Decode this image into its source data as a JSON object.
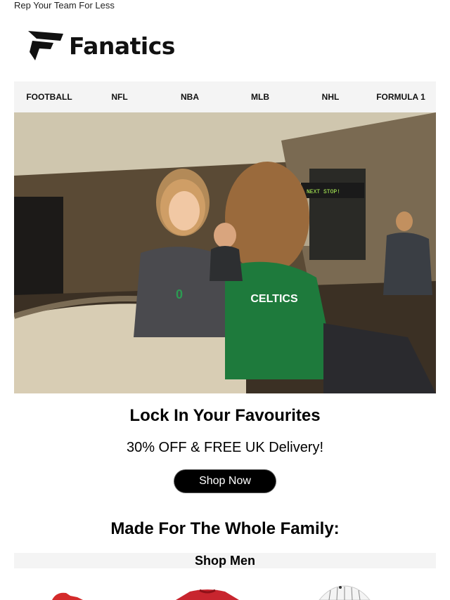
{
  "preheader": "Rep Your Team For Less",
  "brand": {
    "name": "Fanatics",
    "icon": "fanatics-f-logo-icon"
  },
  "nav": [
    {
      "label": "FOOTBALL"
    },
    {
      "label": "NFL"
    },
    {
      "label": "NBA"
    },
    {
      "label": "MLB"
    },
    {
      "label": "NHL"
    },
    {
      "label": "FORMULA 1"
    }
  ],
  "hero": {
    "image": "subway-fans-celtics-jerseys-photo",
    "sign_text": "NEXT STOP!"
  },
  "headline": "Lock In Your Favourites",
  "offer": "30% OFF & FREE UK Delivery!",
  "cta_label": "Shop Now",
  "family_heading": "Made For The Whole Family:",
  "shop_men_label": "Shop Men",
  "colors": {
    "accent": "#000000",
    "nav_bg": "#f4f4f4",
    "jersey_green": "#1e7a3c",
    "product_red": "#d42a2a"
  },
  "products": [
    {
      "image": "red-cap-product"
    },
    {
      "image": "red-jersey-product"
    },
    {
      "image": "white-pinstripe-jersey-product"
    }
  ]
}
